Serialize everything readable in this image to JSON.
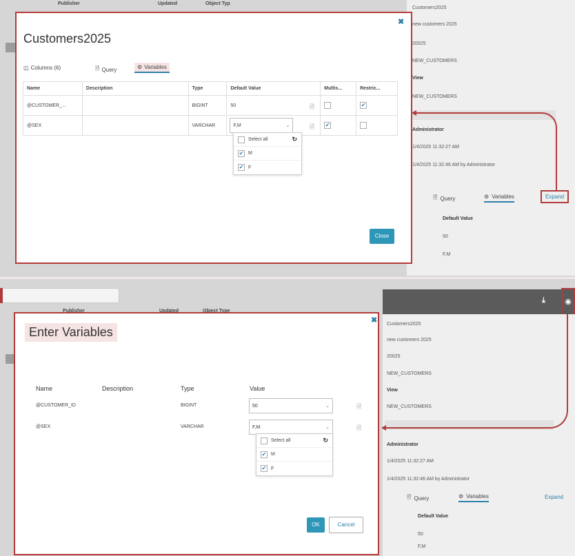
{
  "top": {
    "bg_headers": {
      "publisher": "Publisher",
      "updated": "Updated",
      "object_type": "Object Typ"
    },
    "right_pane": {
      "name": "Customers2025",
      "description": "new customers 2025",
      "id": "20025",
      "table": "NEW_CUSTOMERS",
      "kind": "View",
      "source": "NEW_CUSTOMERS",
      "owner": "Administrator",
      "created": "1/4/2025 11:32:27 AM",
      "modified": "1/4/2025 11:32:46 AM by Administrator",
      "tab_query": "Query",
      "tab_variables": "Variables",
      "expand": "Expand",
      "default_value_header": "Default Value",
      "default_values": [
        "50",
        "F,M"
      ]
    },
    "modal": {
      "title": "Customers2025",
      "tabs": {
        "columns": "Columns (6)",
        "query": "Query",
        "variables": "Variables"
      },
      "headers": [
        "Name",
        "Description",
        "Type",
        "Default Value",
        "Multis...",
        "Restric..."
      ],
      "rows": [
        {
          "name": "@CUSTOMER_...",
          "description": "",
          "type": "BIGINT",
          "default": "50",
          "multi": false,
          "restrict": true
        },
        {
          "name": "@SEX",
          "description": "",
          "type": "VARCHAR",
          "default": "F,M",
          "multi": true,
          "restrict": false
        }
      ],
      "dropdown": {
        "select_all": "Select all",
        "options": [
          "M",
          "F"
        ]
      },
      "close_label": "Close"
    }
  },
  "bottom": {
    "bg_headers": {
      "publisher": "Publisher",
      "updated": "Updated",
      "object_type": "Object Type"
    },
    "right_pane": {
      "name": "Customers2025",
      "description": "new customers 2025",
      "id": "20025",
      "table": "NEW_CUSTOMERS",
      "kind": "View",
      "source": "NEW_CUSTOMERS",
      "owner": "Administrator",
      "created": "1/4/2025 11:32:27 AM",
      "modified": "1/4/2025 11:32:46 AM by Administrator",
      "tab_query": "Query",
      "tab_variables": "Variables",
      "expand": "Expand",
      "default_value_header": "Default Value",
      "default_values": [
        "50",
        "F,M"
      ]
    },
    "modal": {
      "title": "Enter Variables",
      "headers": [
        "Name",
        "Description",
        "Type",
        "Value"
      ],
      "rows": [
        {
          "name": "@CUSTOMER_ID",
          "description": "",
          "type": "BIGINT",
          "value": "50"
        },
        {
          "name": "@SEX",
          "description": "",
          "type": "VARCHAR",
          "value": "F,M"
        }
      ],
      "dropdown": {
        "select_all": "Select all",
        "options": [
          "M",
          "F"
        ]
      },
      "ok_label": "OK",
      "cancel_label": "Cancel"
    }
  },
  "colors": {
    "accent": "#2e7fa8",
    "highlight_border": "#b33a3a",
    "highlight_bg": "#f6e3e3"
  }
}
